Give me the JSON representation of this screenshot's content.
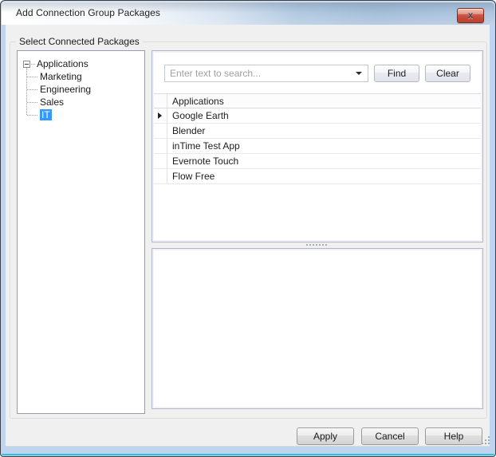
{
  "window": {
    "title": "Add Connection Group Packages"
  },
  "icons": {
    "close_glyph": "x"
  },
  "groupbox": {
    "label": "Select Connected Packages"
  },
  "tree": {
    "root_label": "Applications",
    "items": [
      "Marketing",
      "Engineering",
      "Sales",
      "IT"
    ],
    "selected_item": "IT",
    "expanded": true
  },
  "search": {
    "placeholder": "Enter text to search...",
    "find_label": "Find",
    "clear_label": "Clear",
    "value": ""
  },
  "table": {
    "header": "Applications",
    "rows": [
      "Google Earth",
      "Blender",
      "inTime Test App",
      "Evernote Touch",
      "Flow Free"
    ],
    "current_row": "Google Earth"
  },
  "footer": {
    "apply_label": "Apply",
    "cancel_label": "Cancel",
    "help_label": "Help"
  },
  "colors": {
    "selection_blue": "#3399ff",
    "close_button_red": "#c44837",
    "frame_blue": "#bfd5ef",
    "bottom_edge_cyan": "#2cc3da",
    "client_gray": "#f0f0f0"
  }
}
